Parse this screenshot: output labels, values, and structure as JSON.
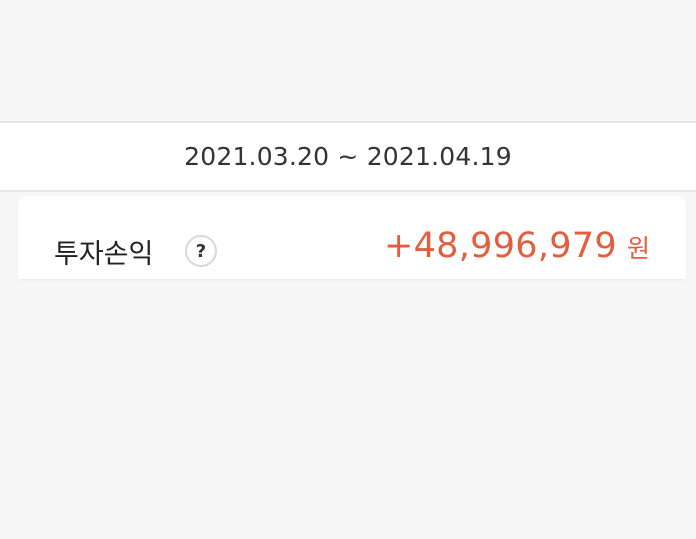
{
  "period": {
    "date_range": "2021.03.20 ~ 2021.04.19"
  },
  "summary": {
    "label": "투자손익",
    "help_icon_glyph": "?",
    "amount": "+48,996,979",
    "unit": "원",
    "amount_color": "#e35d3f"
  },
  "icons": {
    "help": "question-circle-icon"
  }
}
